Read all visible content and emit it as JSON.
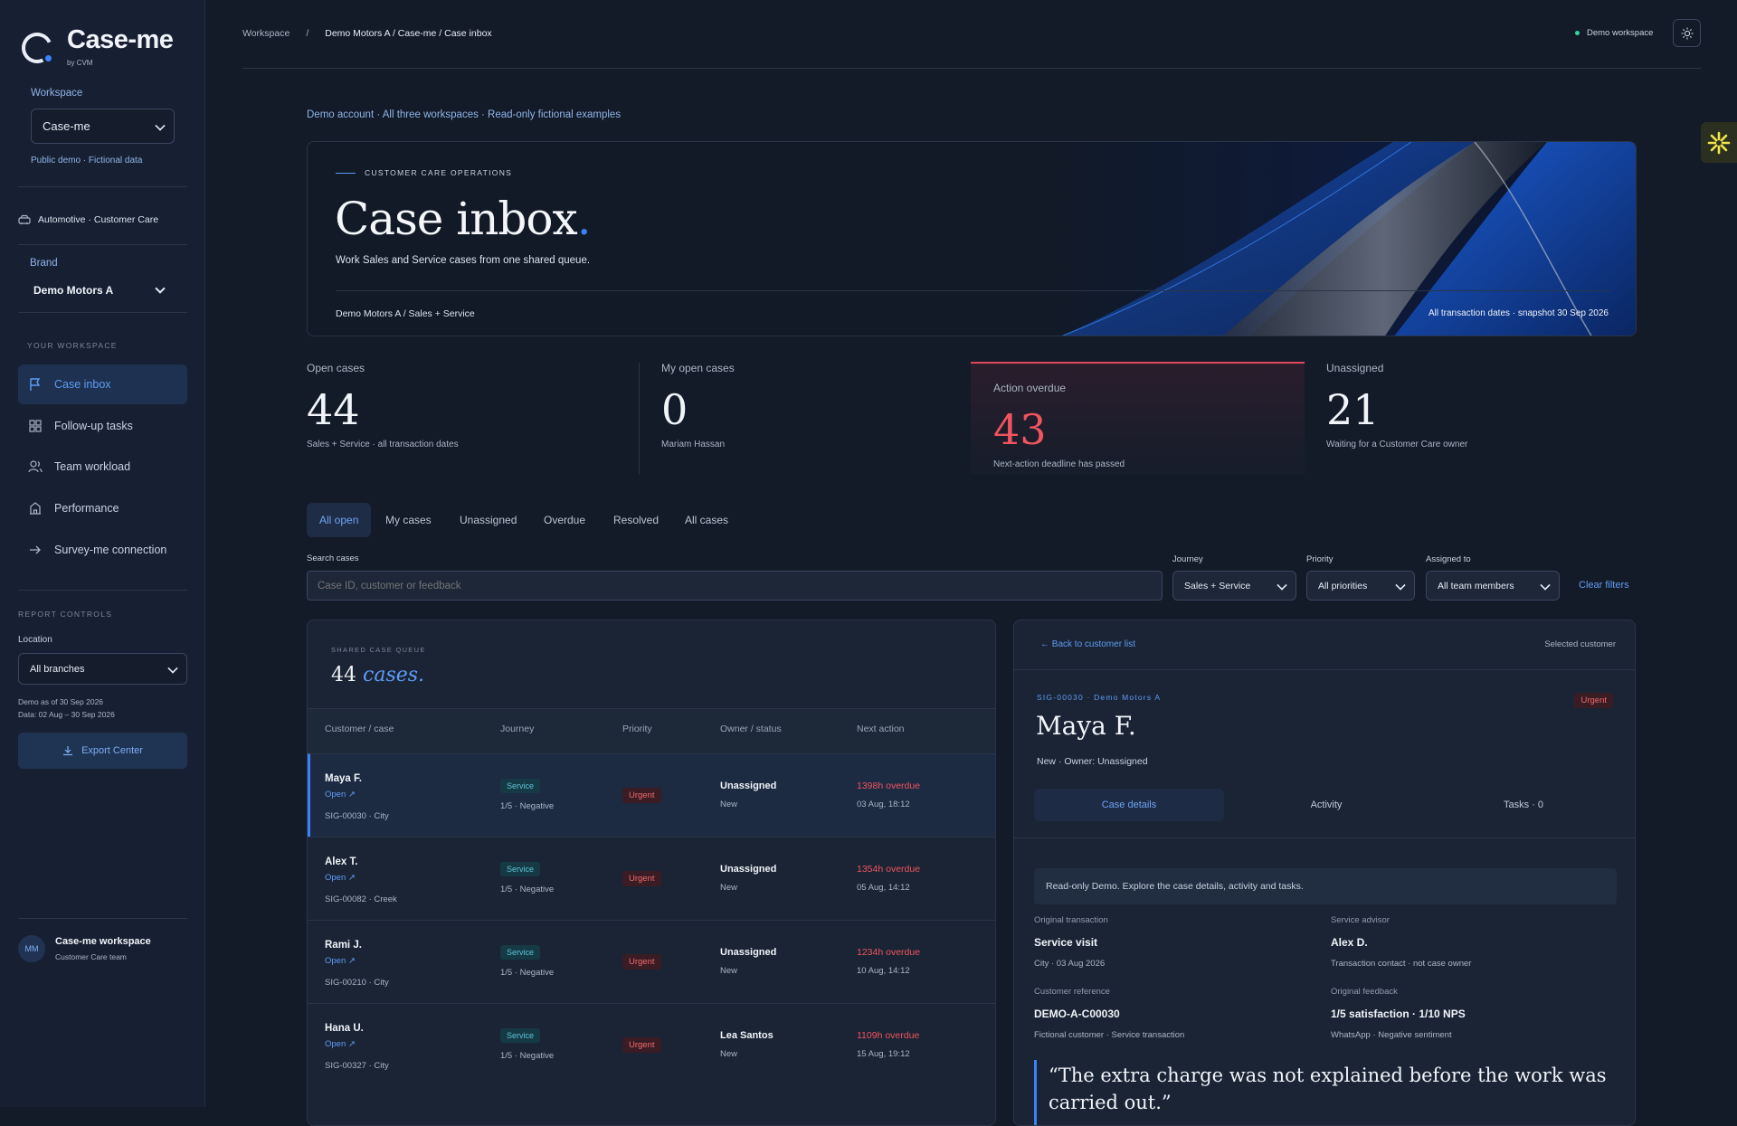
{
  "app": {
    "name": "Case-me",
    "by": "by CVM"
  },
  "sidebar": {
    "workspace_label": "Workspace",
    "workspace_value": "Case-me",
    "public_note": "Public demo · Fictional data",
    "industry": "Automotive · Customer Care",
    "brand_label": "Brand",
    "brand_value": "Demo Motors A",
    "section_label": "YOUR WORKSPACE",
    "nav": [
      {
        "label": "Case inbox",
        "icon": "flag-icon"
      },
      {
        "label": "Follow-up tasks",
        "icon": "grid-icon"
      },
      {
        "label": "Team workload",
        "icon": "users-icon"
      },
      {
        "label": "Performance",
        "icon": "building-icon"
      },
      {
        "label": "Survey-me connection",
        "icon": "arrow-right-icon"
      }
    ],
    "report_controls_label": "REPORT CONTROLS",
    "location_label": "Location",
    "location_value": "All branches",
    "demo_as_of": "Demo as of 30 Sep 2026",
    "data_range": "Data: 02 Aug – 30 Sep 2026",
    "export_label": "Export Center",
    "user_initials": "MM",
    "user_name": "Case-me workspace",
    "user_team": "Customer Care team"
  },
  "header": {
    "crumb_root": "Workspace",
    "crumb_sep": "/",
    "crumb_path": "Demo Motors A / Case-me / Case inbox",
    "workspace_badge": "Demo workspace"
  },
  "account_note": "Demo account · All three workspaces · Read-only fictional examples",
  "hero": {
    "eyebrow": "CUSTOMER CARE OPERATIONS",
    "title": "Case inbox",
    "title_dot": ".",
    "subtitle": "Work Sales and Service cases from one shared queue.",
    "scope": "Demo Motors A / Sales + Service",
    "snapshot": "All transaction dates · snapshot 30 Sep 2026"
  },
  "kpis": [
    {
      "label": "Open cases",
      "value": "44",
      "sub": "Sales + Service · all transaction dates"
    },
    {
      "label": "My open cases",
      "value": "0",
      "sub": "Mariam Hassan"
    },
    {
      "label": "Action overdue",
      "value": "43",
      "sub": "Next-action deadline has passed"
    },
    {
      "label": "Unassigned",
      "value": "21",
      "sub": "Waiting for a Customer Care owner"
    }
  ],
  "tabs": [
    "All open",
    "My cases",
    "Unassigned",
    "Overdue",
    "Resolved",
    "All cases"
  ],
  "filters": {
    "search_label": "Search cases",
    "search_placeholder": "Case ID, customer or feedback",
    "journey_label": "Journey",
    "journey_value": "Sales + Service",
    "priority_label": "Priority",
    "priority_value": "All priorities",
    "assigned_label": "Assigned to",
    "assigned_value": "All team members",
    "clear_label": "Clear filters"
  },
  "queue": {
    "eyebrow": "SHARED CASE QUEUE",
    "count": "44",
    "count_word": "cases.",
    "columns": [
      "Customer / case",
      "Journey",
      "Priority",
      "Owner / status",
      "Next action"
    ],
    "rows": [
      {
        "name": "Maya F.",
        "status": "Open ↗",
        "case": "SIG-00030 · City",
        "journey": "Service",
        "score": "1/5 · Negative",
        "priority": "Urgent",
        "owner": "Unassigned",
        "state": "New",
        "overdue": "1398h overdue",
        "date": "03 Aug, 18:12"
      },
      {
        "name": "Alex T.",
        "status": "Open ↗",
        "case": "SIG-00082 · Creek",
        "journey": "Service",
        "score": "1/5 · Negative",
        "priority": "Urgent",
        "owner": "Unassigned",
        "state": "New",
        "overdue": "1354h overdue",
        "date": "05 Aug, 14:12"
      },
      {
        "name": "Rami J.",
        "status": "Open ↗",
        "case": "SIG-00210 · City",
        "journey": "Service",
        "score": "1/5 · Negative",
        "priority": "Urgent",
        "owner": "Unassigned",
        "state": "New",
        "overdue": "1234h overdue",
        "date": "10 Aug, 14:12"
      },
      {
        "name": "Hana U.",
        "status": "Open ↗",
        "case": "SIG-00327 · City",
        "journey": "Service",
        "score": "1/5 · Negative",
        "priority": "Urgent",
        "owner": "Lea Santos",
        "state": "New",
        "overdue": "1109h overdue",
        "date": "15 Aug, 19:12"
      }
    ]
  },
  "detail": {
    "back_label": "← Back to customer list",
    "selected_label": "Selected customer",
    "case_ref": "SIG-00030 · Demo Motors A",
    "priority": "Urgent",
    "name": "Maya F.",
    "meta": "New · Owner: Unassigned",
    "tabs": [
      "Case details",
      "Activity",
      "Tasks · 0"
    ],
    "notice": "Read-only Demo. Explore the case details, activity and tasks.",
    "fields": [
      {
        "label": "Original transaction",
        "value": "Service visit",
        "sub": "City · 03 Aug 2026"
      },
      {
        "label": "Service advisor",
        "value": "Alex D.",
        "sub": "Transaction contact · not case owner"
      },
      {
        "label": "Customer reference",
        "value": "DEMO-A-C00030",
        "sub": "Fictional customer · Service transaction"
      },
      {
        "label": "Original feedback",
        "value": "1/5 satisfaction · 1/10 NPS",
        "sub": "WhatsApp · Negative sentiment"
      }
    ],
    "quote": "“The extra charge was not explained before the work was carried out.”"
  },
  "colors": {
    "accent": "#3b82f6",
    "danger": "#f0545e",
    "bg": "#141b28",
    "panel": "#1a2434"
  }
}
